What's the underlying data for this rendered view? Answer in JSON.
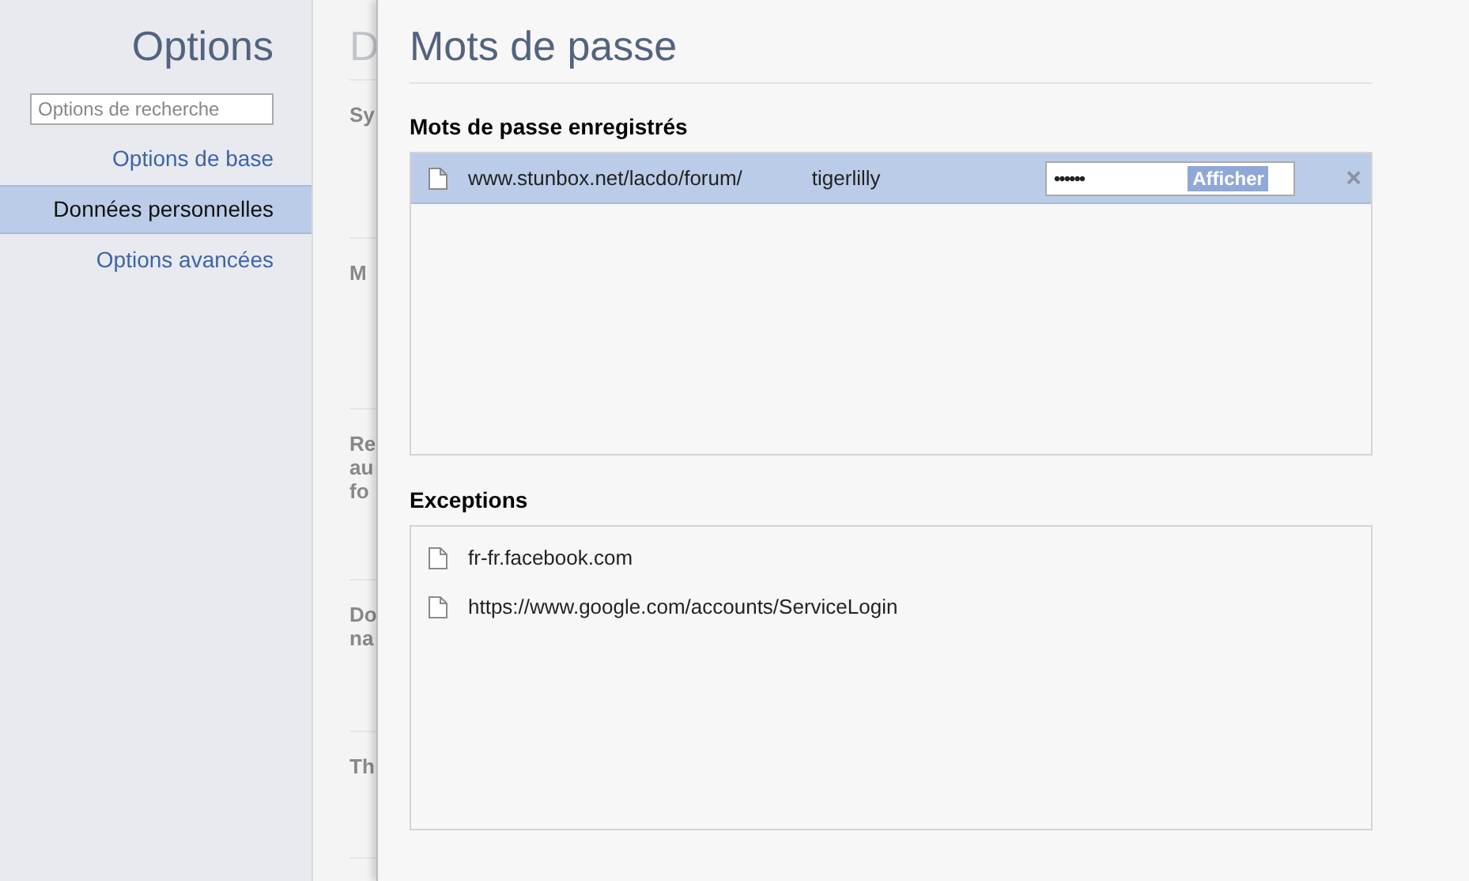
{
  "sidebar": {
    "title": "Options",
    "search": {
      "placeholder": "Options de recherche"
    },
    "items": [
      {
        "label": "Options de base",
        "selected": false
      },
      {
        "label": "Données personnelles",
        "selected": true
      },
      {
        "label": "Options avancées",
        "selected": false
      }
    ]
  },
  "background_page": {
    "title": "D",
    "sections": [
      [
        "Sy"
      ],
      [
        "M"
      ],
      [
        "Re",
        "au",
        "fo"
      ],
      [
        "Do",
        "na"
      ],
      [
        "Th"
      ]
    ]
  },
  "dialog": {
    "title": "Mots de passe",
    "saved": {
      "heading": "Mots de passe enregistrés",
      "rows": [
        {
          "site": "www.stunbox.net/lacdo/forum/",
          "user": "tigerlilly",
          "password": "••••••",
          "show_button": "Afficher",
          "remove": "×",
          "selected": true
        }
      ]
    },
    "exceptions": {
      "heading": "Exceptions",
      "rows": [
        {
          "site": "fr-fr.facebook.com",
          "selected": false
        },
        {
          "site": "https://www.google.com/accounts/ServiceLogin",
          "selected": false
        }
      ]
    }
  }
}
